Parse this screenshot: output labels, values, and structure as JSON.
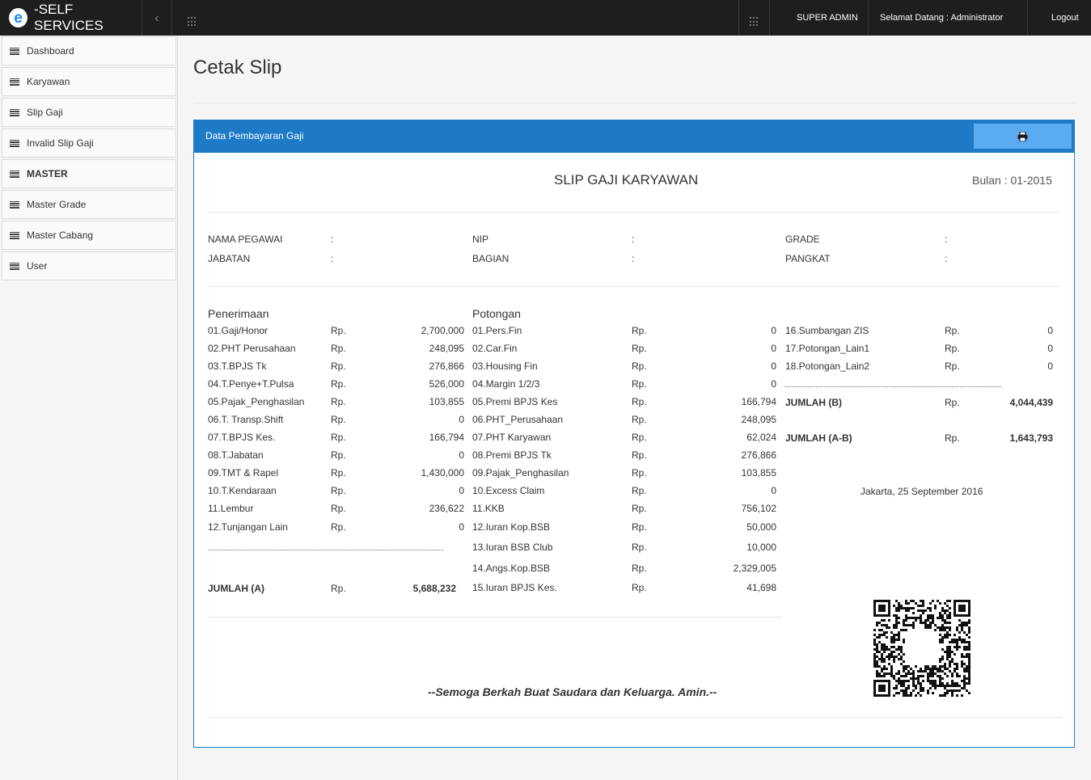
{
  "topbar": {
    "brand_logo": "e",
    "brand_text": "-SELF SERVICES",
    "collapse_icon": "‹",
    "user_role": "SUPER ADMIN",
    "welcome": "Selamat Datang : Administrator",
    "logout": "Logout"
  },
  "sidebar": {
    "items": [
      {
        "label": "Dashboard"
      },
      {
        "label": "Karyawan"
      },
      {
        "label": "Slip Gaji"
      },
      {
        "label": "Invalid Slip Gaji"
      },
      {
        "label": "MASTER"
      },
      {
        "label": "Master Grade"
      },
      {
        "label": "Master Cabang"
      },
      {
        "label": "User"
      }
    ]
  },
  "page": {
    "title": "Cetak Slip"
  },
  "panel": {
    "title": "Data Pembayaran Gaji",
    "print_icon": "printer-icon"
  },
  "slip": {
    "title": "SLIP GAJI KARYAWAN",
    "period": "Bulan : 01-2015",
    "info": {
      "nama_label": "NAMA PEGAWAI",
      "jabatan_label": "JABATAN",
      "nip_label": "NIP",
      "bagian_label": "BAGIAN",
      "grade_label": "GRADE",
      "pangkat_label": "PANGKAT",
      "colon": ":"
    },
    "currency": "Rp.",
    "penerimaan": {
      "heading": "Penerimaan",
      "rows": [
        {
          "label": "01.Gaji/Honor",
          "value": "2,700,000"
        },
        {
          "label": "02.PHT Perusahaan",
          "value": "248,095"
        },
        {
          "label": "03.T.BPJS Tk",
          "value": "276,866"
        },
        {
          "label": "04.T.Penye+T.Pulsa",
          "value": "526,000"
        },
        {
          "label": "05.Pajak_Penghasilan",
          "value": "103,855"
        },
        {
          "label": "06.T. Transp.Shift",
          "value": "0"
        },
        {
          "label": "07.T.BPJS Kes.",
          "value": "166,794"
        },
        {
          "label": "08.T.Jabatan",
          "value": "0"
        },
        {
          "label": "09.TMT & Rapel",
          "value": "1,430,000"
        },
        {
          "label": "10.T.Kendaraan",
          "value": "0"
        },
        {
          "label": "11.Lembur",
          "value": "236,622"
        },
        {
          "label": "12.Tunjangan Lain",
          "value": "0"
        }
      ],
      "total_label": "JUMLAH (A)",
      "total_value": "5,688,232"
    },
    "potongan": {
      "heading": "Potongan",
      "rows": [
        {
          "label": "01.Pers.Fin",
          "value": "0"
        },
        {
          "label": "02.Car.Fin",
          "value": "0"
        },
        {
          "label": "03.Housing Fin",
          "value": "0"
        },
        {
          "label": "04.Margin 1/2/3",
          "value": "0"
        },
        {
          "label": "05.Premi BPJS Kes",
          "value": "166,794"
        },
        {
          "label": "06.PHT_Perusahaan",
          "value": "248,095"
        },
        {
          "label": "07.PHT Karyawan",
          "value": "62,024"
        },
        {
          "label": "08.Premi BPJS Tk",
          "value": "276,866"
        },
        {
          "label": "09.Pajak_Penghasilan",
          "value": "103,855"
        },
        {
          "label": "10.Excess Claim",
          "value": "0"
        },
        {
          "label": "11.KKB",
          "value": "756,102"
        },
        {
          "label": "12.Iuran Kop.BSB",
          "value": "50,000"
        },
        {
          "label": "13.Iuran BSB Club",
          "value": "10,000"
        },
        {
          "label": "14.Angs.Kop.BSB",
          "value": "2,329,005"
        },
        {
          "label": "15.Iuran BPJS Kes.",
          "value": "41,698"
        }
      ],
      "rows2": [
        {
          "label": "16.Sumbangan ZIS",
          "value": "0"
        },
        {
          "label": "17.Potongan_Lain1",
          "value": "0"
        },
        {
          "label": "18.Potongan_Lain2",
          "value": "0"
        }
      ],
      "total_b_label": "JUMLAH (B)",
      "total_b_value": "4,044,439",
      "total_ab_label": "JUMLAH (A-B)",
      "total_ab_value": "1,643,793"
    },
    "place_date": "Jakarta, 25 September 2016",
    "footer_note": "--Semoga Berkah Buat Saudara dan Keluarga. Amin.--"
  }
}
